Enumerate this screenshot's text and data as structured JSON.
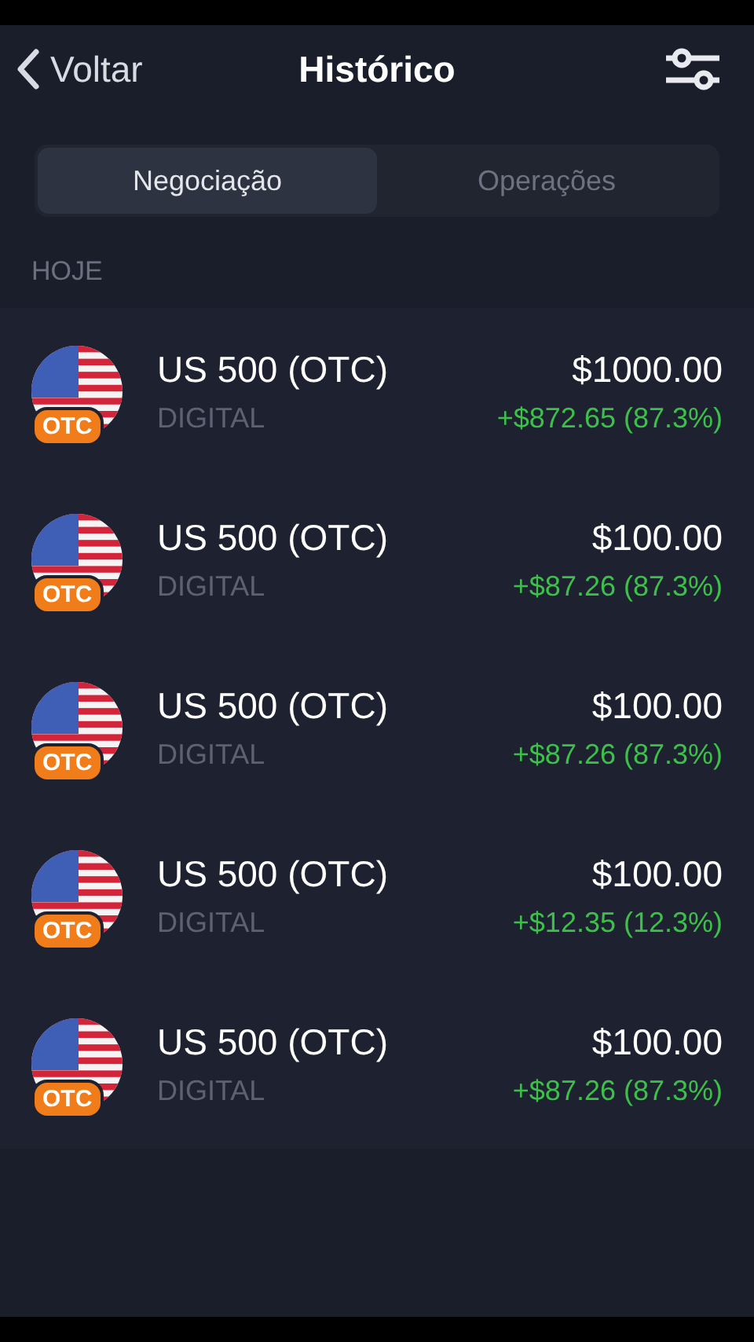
{
  "header": {
    "back": "Voltar",
    "title": "Histórico"
  },
  "tabs": [
    {
      "label": "Negociação",
      "selected": true
    },
    {
      "label": "Operações",
      "selected": false
    }
  ],
  "section": "HOJE",
  "trades": [
    {
      "asset": "US 500 (OTC)",
      "badge": "OTC",
      "type": "DIGITAL",
      "amount": "$1000.00",
      "profit": "+$872.65 (87.3%)"
    },
    {
      "asset": "US 500 (OTC)",
      "badge": "OTC",
      "type": "DIGITAL",
      "amount": "$100.00",
      "profit": "+$87.26 (87.3%)"
    },
    {
      "asset": "US 500 (OTC)",
      "badge": "OTC",
      "type": "DIGITAL",
      "amount": "$100.00",
      "profit": "+$87.26 (87.3%)"
    },
    {
      "asset": "US 500 (OTC)",
      "badge": "OTC",
      "type": "DIGITAL",
      "amount": "$100.00",
      "profit": "+$12.35 (12.3%)"
    },
    {
      "asset": "US 500 (OTC)",
      "badge": "OTC",
      "type": "DIGITAL",
      "amount": "$100.00",
      "profit": "+$87.26 (87.3%)"
    }
  ]
}
